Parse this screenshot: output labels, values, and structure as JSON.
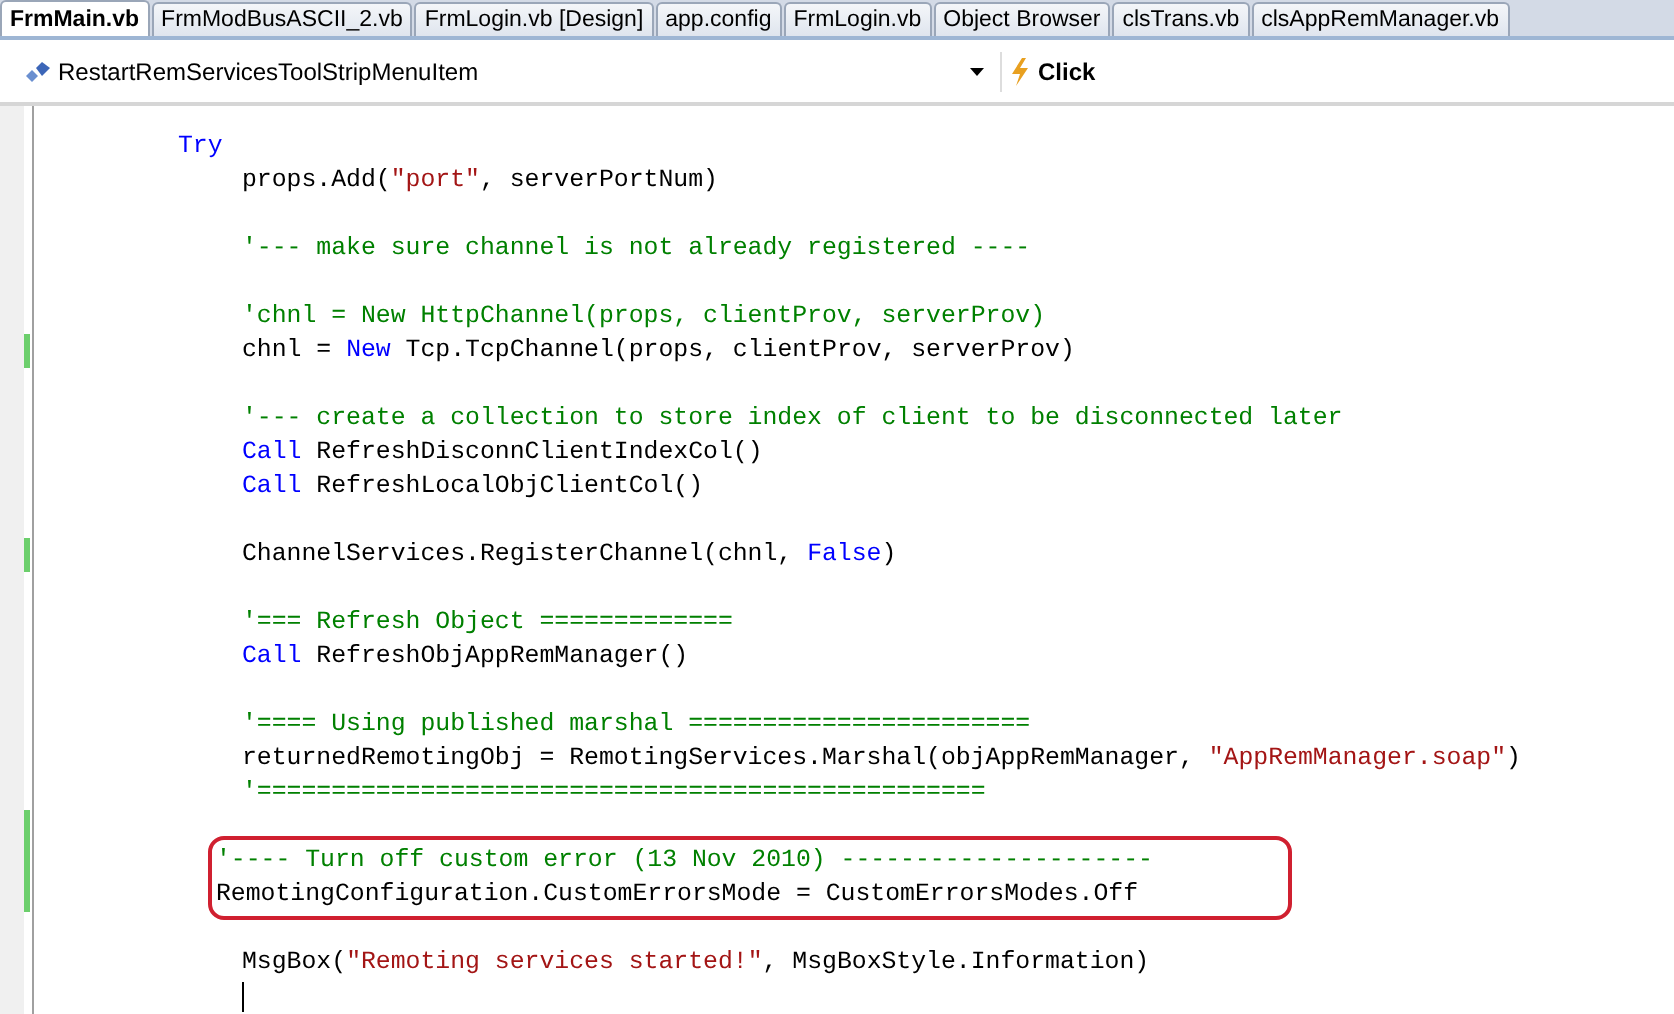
{
  "tabs": [
    {
      "label": "FrmMain.vb",
      "selected": true
    },
    {
      "label": "FrmModBusASCII_2.vb",
      "selected": false
    },
    {
      "label": "FrmLogin.vb [Design]",
      "selected": false
    },
    {
      "label": "app.config",
      "selected": false
    },
    {
      "label": "FrmLogin.vb",
      "selected": false
    },
    {
      "label": "Object Browser",
      "selected": false
    },
    {
      "label": "clsTrans.vb",
      "selected": false
    },
    {
      "label": "clsAppRemManager.vb",
      "selected": false
    }
  ],
  "navigation": {
    "member": "RestartRemServicesToolStripMenuItem",
    "event": "Click"
  },
  "code": [
    {
      "kind": "code",
      "changed": false,
      "tokens": [
        {
          "kind": "keyword",
          "text": "Try"
        }
      ],
      "children": [
        {
          "kind": "code",
          "changed": false,
          "tokens": [
            {
              "kind": "plain",
              "text": "props.Add("
            },
            {
              "kind": "string",
              "text": "\"port\""
            },
            {
              "kind": "plain",
              "text": ", serverPortNum)"
            }
          ]
        },
        {
          "kind": "blank",
          "changed": false
        },
        {
          "kind": "code",
          "changed": false,
          "tokens": [
            {
              "kind": "comment",
              "text": "'--- make sure channel is not already registered ----"
            }
          ]
        },
        {
          "kind": "blank",
          "changed": false
        },
        {
          "kind": "code",
          "changed": false,
          "tokens": [
            {
              "kind": "comment",
              "text": "'chnl = New HttpChannel(props, clientProv, serverProv)"
            }
          ]
        },
        {
          "kind": "code",
          "changed": true,
          "tokens": [
            {
              "kind": "plain",
              "text": "chnl = "
            },
            {
              "kind": "keyword",
              "text": "New"
            },
            {
              "kind": "plain",
              "text": " Tcp.TcpChannel(props, clientProv, serverProv)"
            }
          ]
        },
        {
          "kind": "blank",
          "changed": false
        },
        {
          "kind": "code",
          "changed": false,
          "tokens": [
            {
              "kind": "comment",
              "text": "'--- create a collection to store index of client to be disconnected later"
            }
          ]
        },
        {
          "kind": "code",
          "changed": false,
          "tokens": [
            {
              "kind": "keyword",
              "text": "Call"
            },
            {
              "kind": "plain",
              "text": " RefreshDisconnClientIndexCol()"
            }
          ]
        },
        {
          "kind": "code",
          "changed": false,
          "tokens": [
            {
              "kind": "keyword",
              "text": "Call"
            },
            {
              "kind": "plain",
              "text": " RefreshLocalObjClientCol()"
            }
          ]
        },
        {
          "kind": "blank",
          "changed": false
        },
        {
          "kind": "code",
          "changed": true,
          "tokens": [
            {
              "kind": "plain",
              "text": "ChannelServices.RegisterChannel(chnl, "
            },
            {
              "kind": "keyword",
              "text": "False"
            },
            {
              "kind": "plain",
              "text": ")"
            }
          ]
        },
        {
          "kind": "blank",
          "changed": false
        },
        {
          "kind": "code",
          "changed": false,
          "tokens": [
            {
              "kind": "comment",
              "text": "'=== Refresh Object ============="
            }
          ]
        },
        {
          "kind": "code",
          "changed": false,
          "tokens": [
            {
              "kind": "keyword",
              "text": "Call"
            },
            {
              "kind": "plain",
              "text": " RefreshObjAppRemManager()"
            }
          ]
        },
        {
          "kind": "blank",
          "changed": false
        },
        {
          "kind": "code",
          "changed": false,
          "tokens": [
            {
              "kind": "comment",
              "text": "'==== Using published marshal ======================="
            }
          ]
        },
        {
          "kind": "code",
          "changed": false,
          "tokens": [
            {
              "kind": "plain",
              "text": "returnedRemotingObj = RemotingServices.Marshal(objAppRemManager, "
            },
            {
              "kind": "string",
              "text": "\"AppRemManager.soap\""
            },
            {
              "kind": "plain",
              "text": ")"
            }
          ]
        },
        {
          "kind": "code",
          "changed": false,
          "tokens": [
            {
              "kind": "comment",
              "text": "'================================================="
            }
          ]
        },
        {
          "kind": "blank",
          "changed": true
        },
        {
          "kind": "callout",
          "children": [
            {
              "kind": "code",
              "changed": true,
              "tokens": [
                {
                  "kind": "comment",
                  "text": "'---- Turn off custom error (13 Nov 2010) ---------------------"
                }
              ]
            },
            {
              "kind": "code",
              "changed": true,
              "tokens": [
                {
                  "kind": "plain",
                  "text": "RemotingConfiguration.CustomErrorsMode = CustomErrorsModes.Off"
                }
              ]
            }
          ]
        },
        {
          "kind": "blank",
          "changed": false
        },
        {
          "kind": "code",
          "changed": false,
          "tokens": [
            {
              "kind": "plain",
              "text": "MsgBox("
            },
            {
              "kind": "string",
              "text": "\"Remoting services started!\""
            },
            {
              "kind": "plain",
              "text": ", MsgBoxStyle.Information)"
            }
          ]
        },
        {
          "kind": "cursor",
          "changed": false
        }
      ]
    }
  ]
}
